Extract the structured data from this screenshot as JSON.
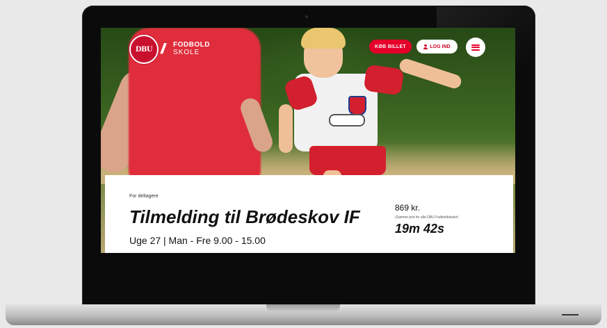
{
  "header": {
    "logo_seal_text": "DBU",
    "logo_line1": "FODBOLD",
    "logo_line2": "SKOLE",
    "buy_button_label": "KØB BILLET",
    "login_button_label": "LOG IND",
    "menu_icon": "hamburger-menu-icon",
    "user_icon": "user-icon"
  },
  "card": {
    "label": "For deltagere",
    "title": "Tilmelding til Brødeskov IF",
    "schedule": "Uge 27 | Man - Fre 9.00 - 15.00",
    "price": "869 kr.",
    "price_note": "(Samme pris for alle DBU Fodboldskoler)",
    "countdown": "19m 42s"
  },
  "colors": {
    "brand_red": "#e4002b",
    "text_dark": "#111111"
  }
}
